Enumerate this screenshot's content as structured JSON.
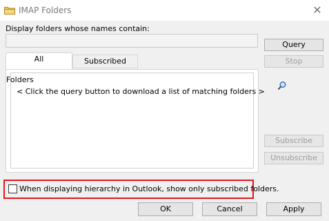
{
  "window": {
    "title": "IMAP Folders",
    "title_icon": "folder-icon",
    "close_icon": "close-icon",
    "close_glyph": "✕"
  },
  "search": {
    "label": "Display folders whose names contain:",
    "value": "",
    "placeholder": ""
  },
  "buttons": {
    "query": "Query",
    "stop": "Stop",
    "subscribe": "Subscribe",
    "unsubscribe": "Unsubscribe",
    "ok": "OK",
    "cancel": "Cancel",
    "apply": "Apply"
  },
  "tabs": [
    {
      "label": "All",
      "selected": true
    },
    {
      "label": "Subscribed",
      "selected": false
    }
  ],
  "list": {
    "header": "Folders",
    "hint": "< Click the query button to download a list of matching folders >"
  },
  "option": {
    "label": "When displaying hierarchy in Outlook, show only subscribed folders.",
    "checked": false
  },
  "colors": {
    "highlight": "#e3151b",
    "folder_icon": "#e8b84a"
  }
}
